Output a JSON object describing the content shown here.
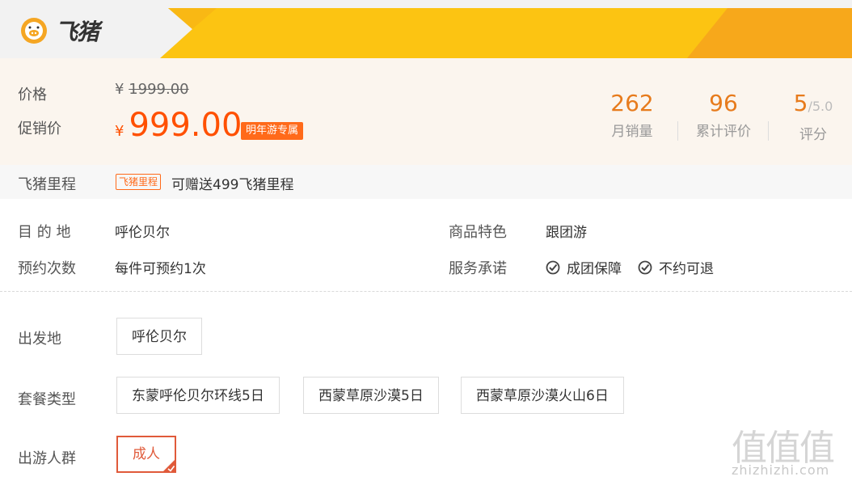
{
  "header": {
    "logo_text": "飞猪"
  },
  "price": {
    "label_price": "价格",
    "label_promo": "促销价",
    "currency": "¥",
    "original": "1999.00",
    "promo": "999.00",
    "promo_tag": "明年游专属"
  },
  "stats": [
    {
      "value": "262",
      "label": "月销量"
    },
    {
      "value": "96",
      "label": "累计评价"
    },
    {
      "value": "5",
      "suffix": "/5.0",
      "label": "评分"
    }
  ],
  "mileage": {
    "label": "飞猪里程",
    "tag": "飞猪里程",
    "text": "可赠送499飞猪里程"
  },
  "info": {
    "dest_label": "目 的 地",
    "dest_value": "呼伦贝尔",
    "feature_label": "商品特色",
    "feature_value": "跟团游",
    "booking_label": "预约次数",
    "booking_value": "每件可预约1次",
    "service_label": "服务承诺",
    "services": [
      "成团保障",
      "不约可退"
    ]
  },
  "options": {
    "departure_label": "出发地",
    "departure": [
      "呼伦贝尔"
    ],
    "package_label": "套餐类型",
    "packages": [
      "东蒙呼伦贝尔环线5日",
      "西蒙草原沙漠5日",
      "西蒙草原沙漠火山6日"
    ],
    "crowd_label": "出游人群",
    "crowd": [
      "成人"
    ]
  },
  "watermark": {
    "big": "值值值",
    "small": "zhizhizhi.com"
  },
  "colors": {
    "accent": "#ff5000",
    "orange_stat": "#e77b1c",
    "header_yellow": "#fcc412"
  }
}
